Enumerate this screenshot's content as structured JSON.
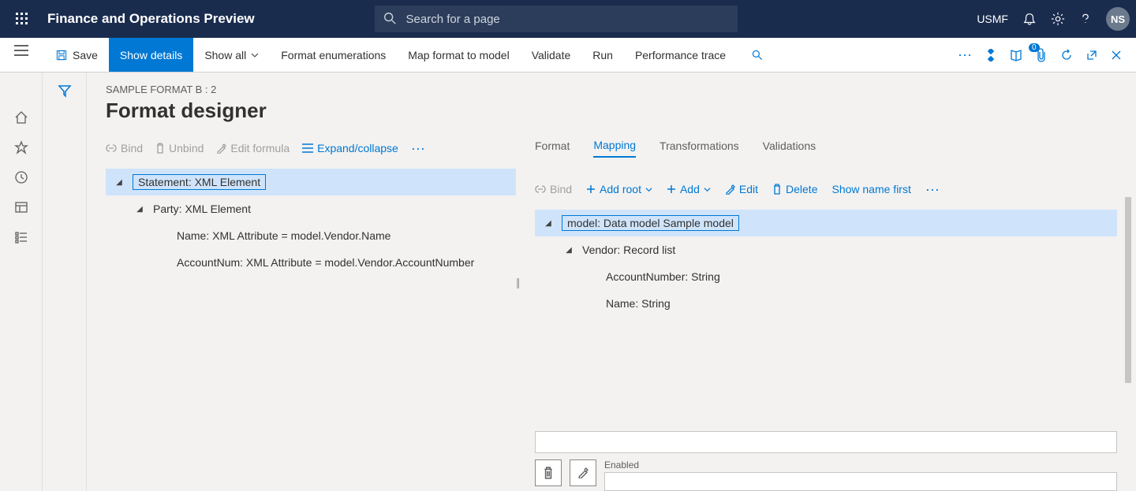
{
  "top": {
    "app_title": "Finance and Operations Preview",
    "search_placeholder": "Search for a page",
    "company": "USMF",
    "avatar_initials": "NS"
  },
  "actions": {
    "save": "Save",
    "show_details": "Show details",
    "show_all": "Show all",
    "format_enum": "Format enumerations",
    "map_format": "Map format to model",
    "validate": "Validate",
    "run": "Run",
    "perf_trace": "Performance trace",
    "badge_count": "0"
  },
  "page": {
    "breadcrumb": "SAMPLE FORMAT B : 2",
    "title": "Format designer"
  },
  "left_tools": {
    "bind": "Bind",
    "unbind": "Unbind",
    "edit_formula": "Edit formula",
    "expand": "Expand/collapse"
  },
  "format_tree": {
    "root": "Statement: XML Element",
    "party": "Party: XML Element",
    "name_attr": "Name: XML Attribute = model.Vendor.Name",
    "acct_attr": "AccountNum: XML Attribute = model.Vendor.AccountNumber"
  },
  "tabs": {
    "format": "Format",
    "mapping": "Mapping",
    "transformations": "Transformations",
    "validations": "Validations"
  },
  "right_tools": {
    "bind": "Bind",
    "add_root": "Add root",
    "add": "Add",
    "edit": "Edit",
    "delete": "Delete",
    "show_name_first": "Show name first"
  },
  "model_tree": {
    "root": "model: Data model Sample model",
    "vendor": "Vendor: Record list",
    "acct": "AccountNumber: String",
    "name": "Name: String"
  },
  "bottom": {
    "enabled_label": "Enabled"
  }
}
